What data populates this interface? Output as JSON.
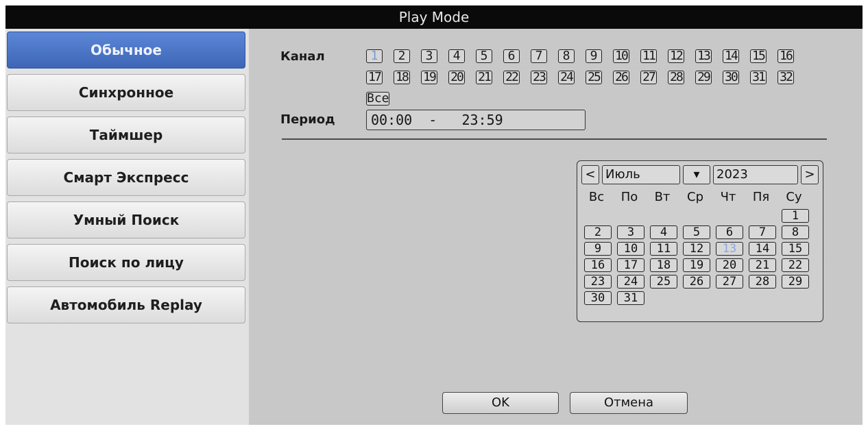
{
  "title": "Play Mode",
  "sidebar": {
    "items": [
      {
        "label": "Обычное",
        "active": true
      },
      {
        "label": "Синхронное",
        "active": false
      },
      {
        "label": "Таймшер",
        "active": false
      },
      {
        "label": "Смарт Экспресс",
        "active": false
      },
      {
        "label": "Умный Поиск",
        "active": false
      },
      {
        "label": "Поиск по лицу",
        "active": false
      },
      {
        "label": "Автомобиль Replay",
        "active": false
      }
    ]
  },
  "main": {
    "channel_label": "Канал",
    "channels": [
      "1",
      "2",
      "3",
      "4",
      "5",
      "6",
      "7",
      "8",
      "9",
      "10",
      "11",
      "12",
      "13",
      "14",
      "15",
      "16",
      "17",
      "18",
      "19",
      "20",
      "21",
      "22",
      "23",
      "24",
      "25",
      "26",
      "27",
      "28",
      "29",
      "30",
      "31",
      "32"
    ],
    "selected_channel": "1",
    "all_label": "Все",
    "period_label": "Период",
    "period_value": "00:00  -   23:59"
  },
  "calendar": {
    "prev": "<",
    "next": ">",
    "month": "Июль",
    "year": "2023",
    "dropdown_arrow": "▾",
    "weekdays": [
      "Вс",
      "По",
      "Вт",
      "Ср",
      "Чт",
      "Пя",
      "Су"
    ],
    "days": [
      "1",
      "2",
      "3",
      "4",
      "5",
      "6",
      "7",
      "8",
      "9",
      "10",
      "11",
      "12",
      "13",
      "14",
      "15",
      "16",
      "17",
      "18",
      "19",
      "20",
      "21",
      "22",
      "23",
      "24",
      "25",
      "26",
      "27",
      "28",
      "29",
      "30",
      "31"
    ],
    "selected_day": "13"
  },
  "buttons": {
    "ok": "OK",
    "cancel": "Отмена"
  },
  "colors": {
    "active": "#4a73c4",
    "panel": "#c7c7c7",
    "titlebar": "#0a0a0a"
  }
}
